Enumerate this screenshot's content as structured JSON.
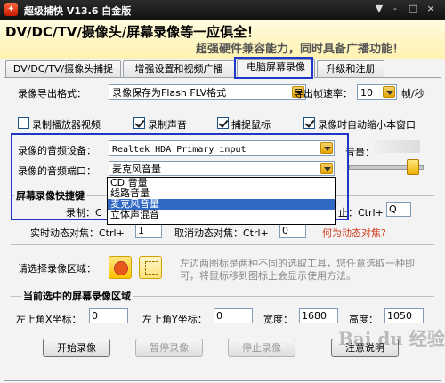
{
  "window": {
    "title": "超级捕快 V13.6 白金版",
    "controls": [
      "▼",
      "-",
      "□",
      "×"
    ]
  },
  "banner": {
    "slogan_main": "DV/DC/TV/摄像头/屏幕录像等一应俱全！",
    "slogan_sub": "超强硬件兼容能力，同时具备广播功能！"
  },
  "tabs": [
    {
      "label": "DV/DC/TV/摄像头捕捉",
      "active": false
    },
    {
      "label": "增强设置和视频广播",
      "active": false
    },
    {
      "label": "电脑屏幕录像",
      "active": true
    },
    {
      "label": "升级和注册",
      "active": false
    }
  ],
  "export": {
    "label": "录像导出格式：",
    "value": "录像保存为Flash FLV格式",
    "fps_label": "导出帧速率：",
    "fps_value": "10",
    "fps_unit": "帧/秒"
  },
  "checkboxes": [
    {
      "label": "录制播放器视频",
      "checked": false
    },
    {
      "label": "录制声音",
      "checked": true
    },
    {
      "label": "捕捉鼠标",
      "checked": true
    },
    {
      "label": "录像时自动缩小本窗口",
      "checked": true
    }
  ],
  "audio": {
    "device_label": "录像的音频设备：",
    "device_value": "Realtek HDA Primary input",
    "port_label": "录像的音频端口：",
    "port_value": "麦克风音量",
    "volume_label": "音量：",
    "options": [
      "CD 音量",
      "线路音量",
      "麦克风音量",
      "立体声混音"
    ],
    "selected_option": "麦克风音量"
  },
  "hotkeys": {
    "group_title": "屏幕录像快捷键",
    "record_label": "录制：C",
    "stop_label": "止：Ctrl+",
    "stop_key": "Q",
    "realtime_label": "实时动态对焦：Ctrl+",
    "realtime_key": "1",
    "cancel_label": "取消动态对焦：Ctrl+",
    "cancel_key": "0",
    "help_link": "何为动态对焦?"
  },
  "region": {
    "label": "请选择录像区域：",
    "description": "左边两图标是两种不同的选取工具，您任意选取一种即可，将鼠标移到图标上会显示使用方法。"
  },
  "current_region": {
    "group_title": "当前选中的屏幕录像区域",
    "x_label": "左上角X坐标：",
    "x_value": "0",
    "y_label": "左上角Y坐标：",
    "y_value": "0",
    "width_label": "宽度：",
    "width_value": "1680",
    "height_label": "高度：",
    "height_value": "1050"
  },
  "buttons": {
    "start": "开始录像",
    "pause": "暂停录像",
    "stop": "停止录像",
    "notes": "注意说明"
  },
  "watermark": "Bai du 经验"
}
